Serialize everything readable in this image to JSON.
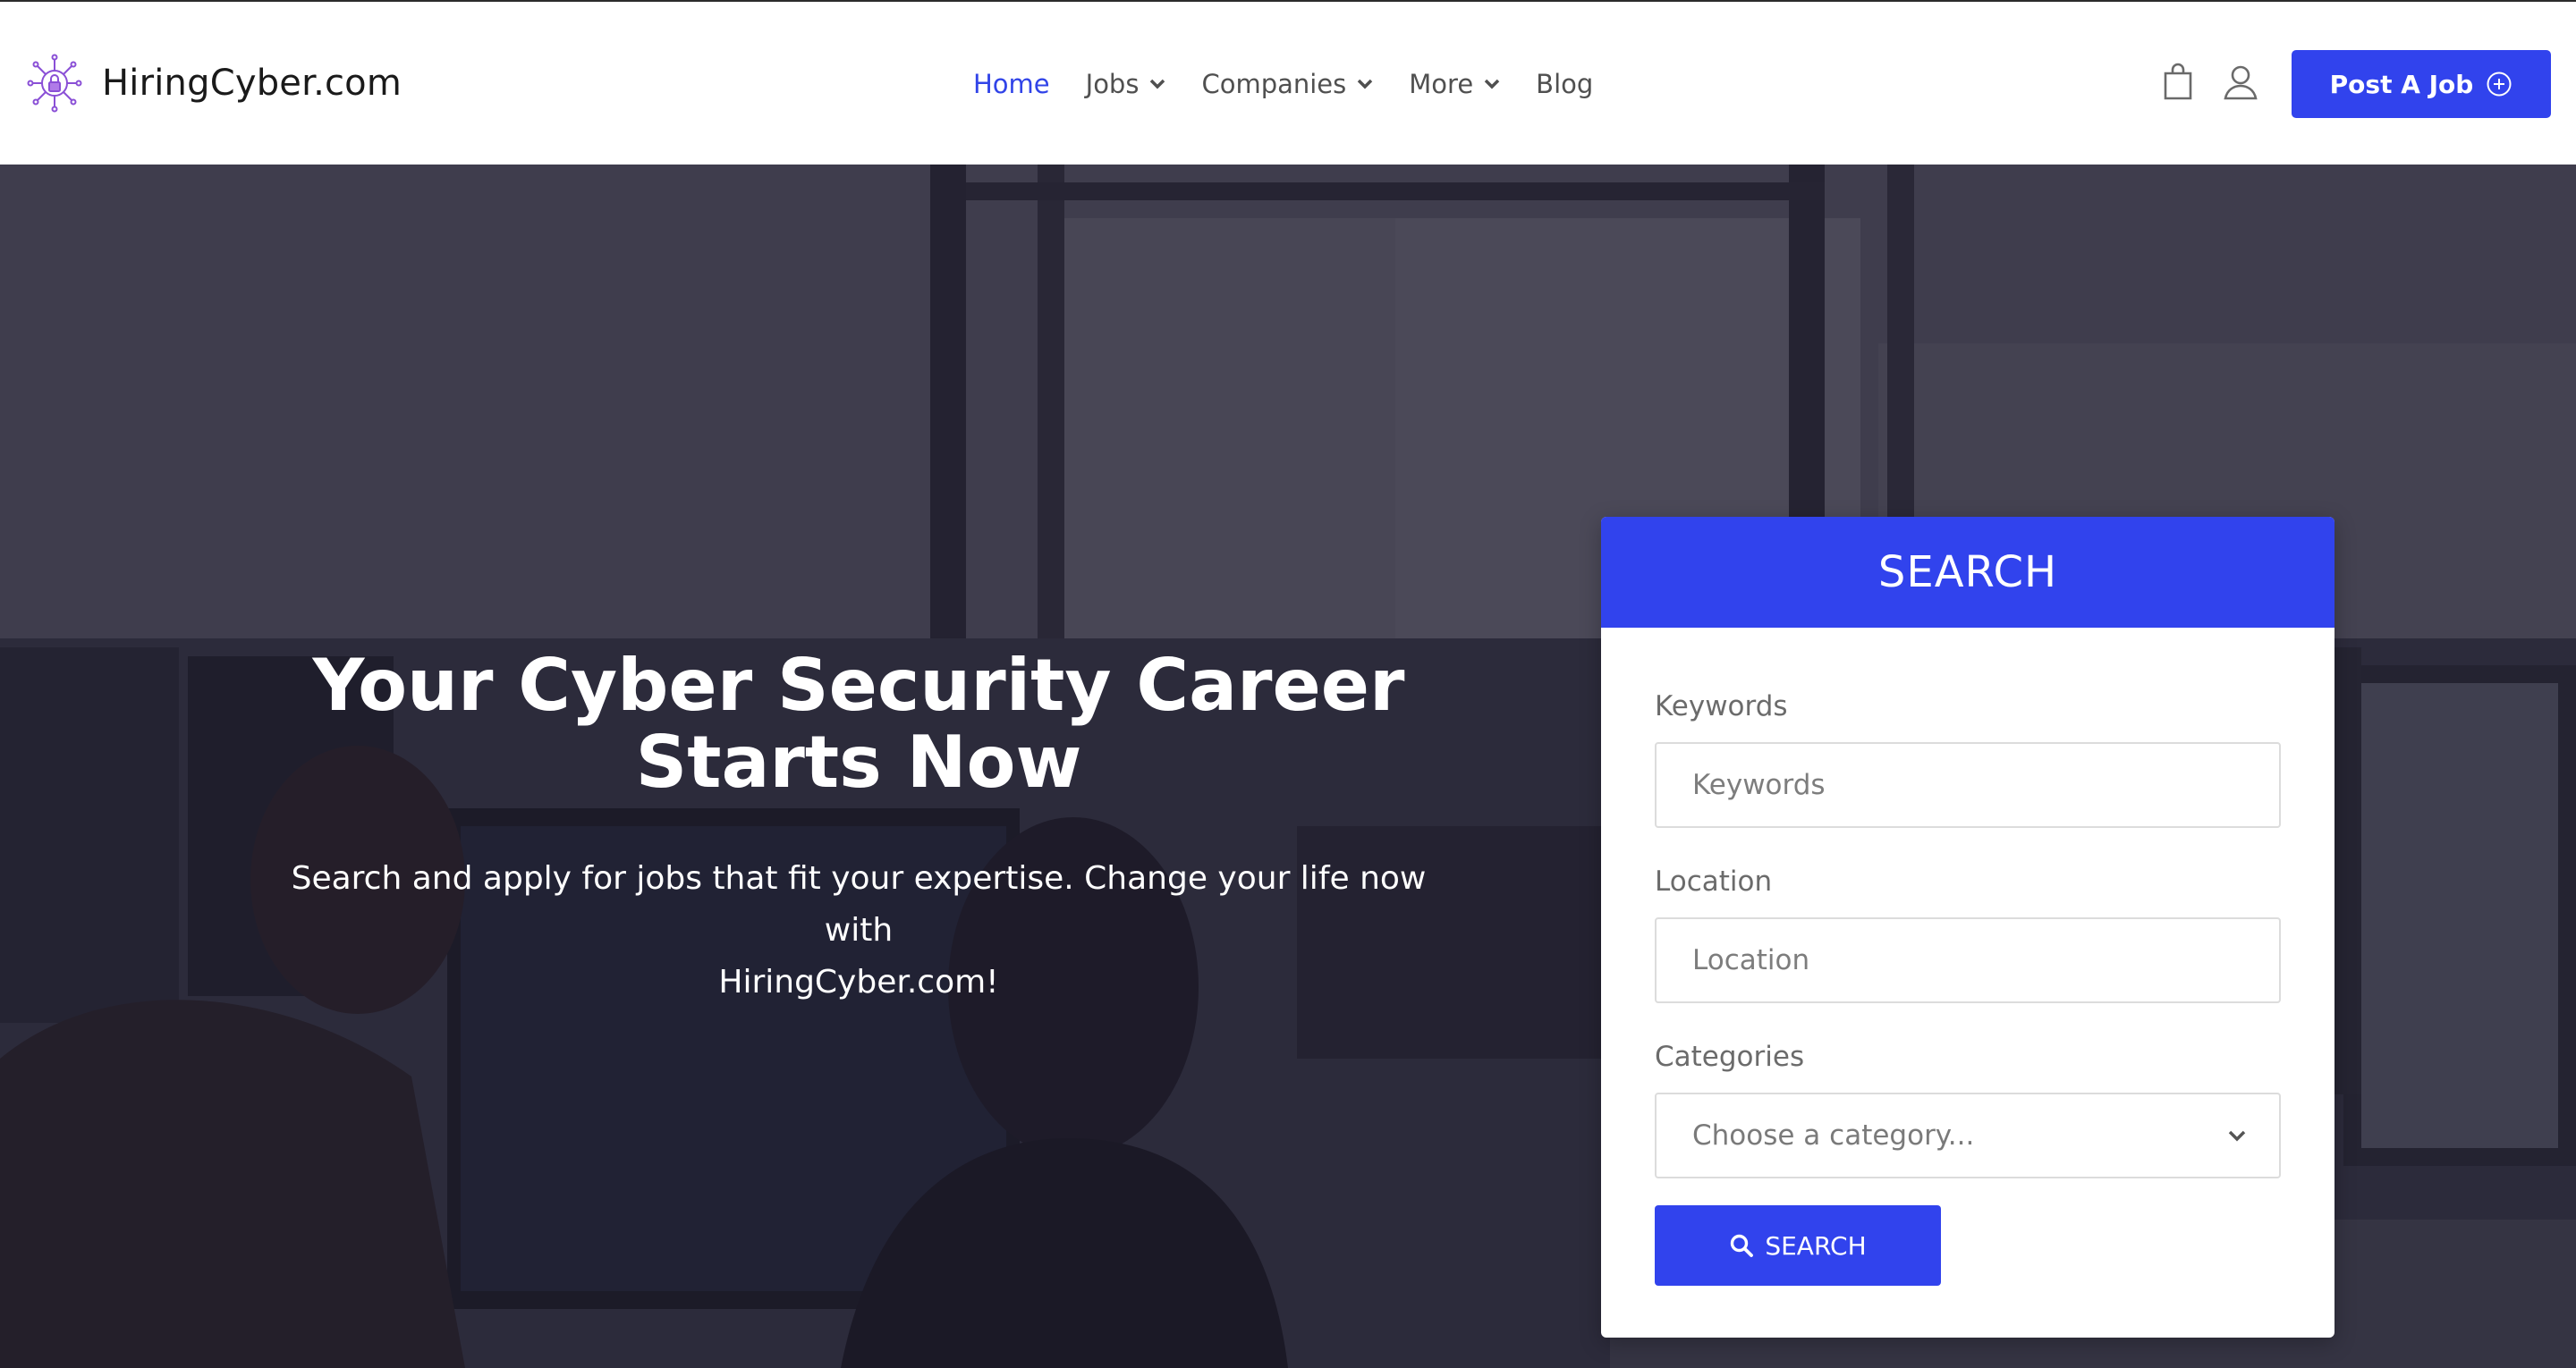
{
  "brand": {
    "name": "HiringCyber.com",
    "logo_icon": "cyber-lock-circuit-icon",
    "logo_color": "#8a4fd6"
  },
  "nav": {
    "items": [
      {
        "label": "Home",
        "active": true,
        "dropdown": false
      },
      {
        "label": "Jobs",
        "active": false,
        "dropdown": true
      },
      {
        "label": "Companies",
        "active": false,
        "dropdown": true
      },
      {
        "label": "More",
        "active": false,
        "dropdown": true
      },
      {
        "label": "Blog",
        "active": false,
        "dropdown": false
      }
    ],
    "active_color": "#3144e8"
  },
  "header_icons": [
    "shopping-bag-icon",
    "user-icon"
  ],
  "post_job": {
    "label": "Post A Job",
    "icon": "plus-circle-icon"
  },
  "hero": {
    "title_line1": "Your Cyber Security Career",
    "title_line2": "Starts Now",
    "subtitle_line1": "Search and apply for jobs that fit your expertise. Change your life now with",
    "subtitle_line2": "HiringCyber.com!"
  },
  "search": {
    "heading": "SEARCH",
    "keywords": {
      "label": "Keywords",
      "placeholder": "Keywords",
      "value": ""
    },
    "location": {
      "label": "Location",
      "placeholder": "Location",
      "value": ""
    },
    "categories": {
      "label": "Categories",
      "selected": "Choose a category..."
    },
    "button_label": "SEARCH",
    "button_icon": "search-icon"
  },
  "colors": {
    "primary": "#3143ed",
    "header_bg": "#ffffff",
    "text_dark": "#1a1a1a"
  }
}
